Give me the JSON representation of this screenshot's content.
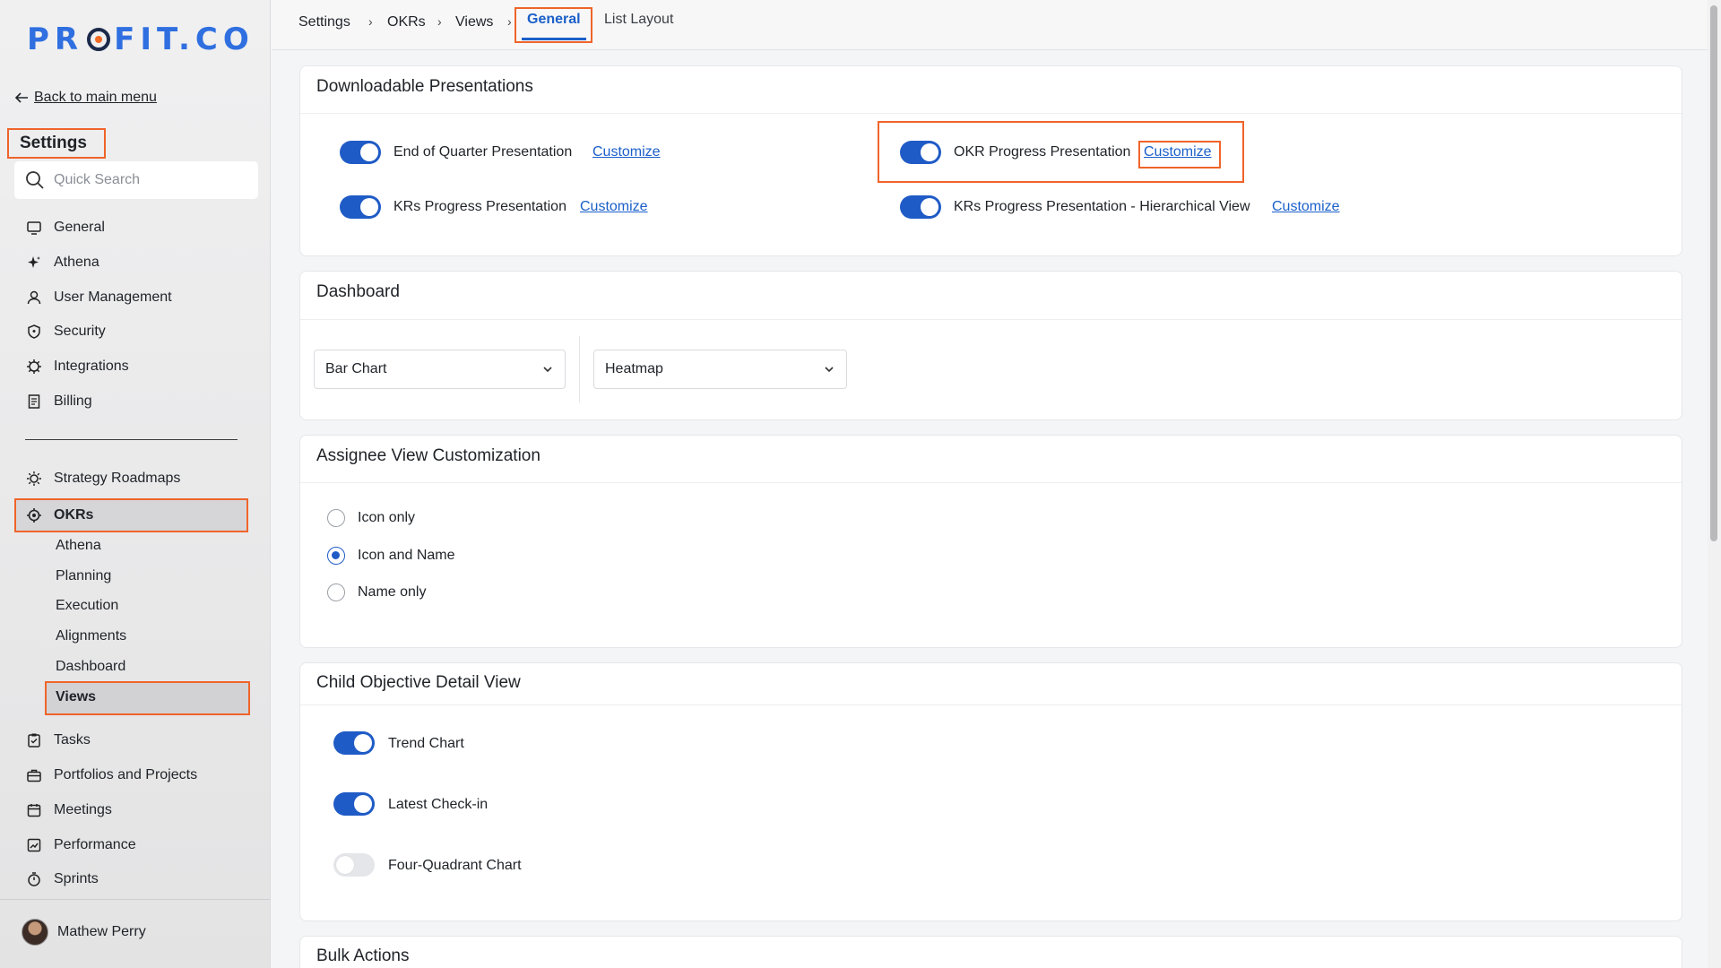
{
  "sidebar": {
    "logo": "PROFIT.CO",
    "back_label": "Back to main menu",
    "settings_title": "Settings",
    "search_placeholder": "Quick Search",
    "items": [
      {
        "label": "General",
        "icon": "monitor-icon"
      },
      {
        "label": "Athena",
        "icon": "sparkle-icon"
      },
      {
        "label": "User Management",
        "icon": "user-icon"
      },
      {
        "label": "Security",
        "icon": "shield-icon"
      },
      {
        "label": "Integrations",
        "icon": "gear-icon"
      },
      {
        "label": "Billing",
        "icon": "receipt-icon"
      }
    ],
    "items2": [
      {
        "label": "Strategy Roadmaps",
        "icon": "bulb-icon"
      },
      {
        "label": "OKRs",
        "icon": "target-icon"
      }
    ],
    "okr_subitems": [
      "Athena",
      "Planning",
      "Execution",
      "Alignments",
      "Dashboard",
      "Views"
    ],
    "items3": [
      {
        "label": "Tasks",
        "icon": "clipboard-check-icon"
      },
      {
        "label": "Portfolios and Projects",
        "icon": "briefcase-icon"
      },
      {
        "label": "Meetings",
        "icon": "calendar-icon"
      },
      {
        "label": "Performance",
        "icon": "chart-line-icon"
      },
      {
        "label": "Sprints",
        "icon": "stopwatch-icon"
      }
    ],
    "user_name": "Mathew Perry"
  },
  "breadcrumb": {
    "items": [
      "Settings",
      "OKRs",
      "Views"
    ],
    "active_tab": "General",
    "other_tab": "List Layout"
  },
  "downloadable": {
    "title": "Downloadable Presentations",
    "items": [
      {
        "label": "End of Quarter Presentation",
        "link": "Customize",
        "on": true
      },
      {
        "label": "OKR Progress Presentation",
        "link": "Customize",
        "on": true
      },
      {
        "label": "KRs Progress Presentation",
        "link": "Customize",
        "on": true
      },
      {
        "label": "KRs Progress Presentation - Hierarchical View",
        "link": "Customize",
        "on": true
      }
    ]
  },
  "dashboard": {
    "title": "Dashboard",
    "select1": "Bar Chart",
    "select2": "Heatmap"
  },
  "assignee": {
    "title": "Assignee View Customization",
    "options": [
      "Icon only",
      "Icon and Name",
      "Name only"
    ],
    "selected": "Icon and Name"
  },
  "child_detail": {
    "title": "Child Objective Detail View",
    "items": [
      {
        "label": "Trend Chart",
        "on": true
      },
      {
        "label": "Latest Check-in",
        "on": true
      },
      {
        "label": "Four-Quadrant Chart",
        "on": false
      }
    ]
  },
  "bulk": {
    "title": "Bulk Actions"
  },
  "colors": {
    "accent": "#1f5bc6",
    "highlight": "#f0642a"
  }
}
